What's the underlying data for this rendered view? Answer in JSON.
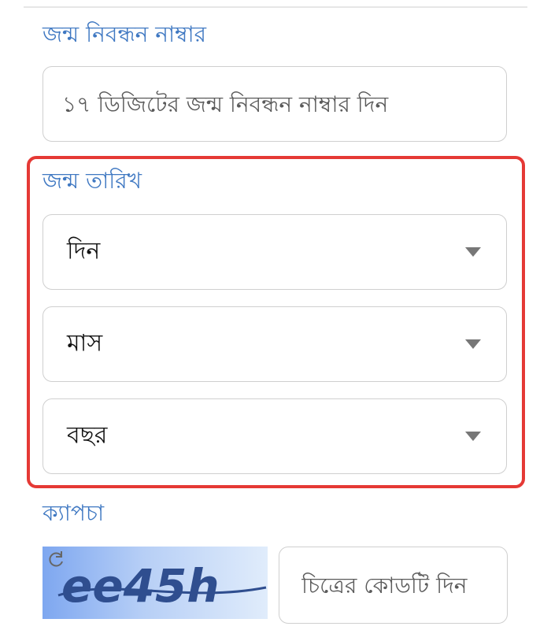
{
  "registration": {
    "label": "জন্ম নিবন্ধন নাম্বার",
    "placeholder": "১৭ ডিজিটের জন্ম নিবন্ধন নাম্বার দিন"
  },
  "dob": {
    "label": "জন্ম তারিখ",
    "day": {
      "value": "দিন",
      "icon": "caret-down"
    },
    "month": {
      "value": "মাস",
      "icon": "caret-down"
    },
    "year": {
      "value": "বছর",
      "icon": "caret-down"
    },
    "highlight_color": "#e53935"
  },
  "captcha": {
    "label": "ক্যাপচা",
    "image_text": "ee45h",
    "refresh_icon": "refresh-icon",
    "placeholder": "চিত্রের কোডটি দিন"
  },
  "colors": {
    "label": "#3f78c2",
    "border": "#cfcfcf",
    "captcha_text": "#2f4e8f"
  }
}
